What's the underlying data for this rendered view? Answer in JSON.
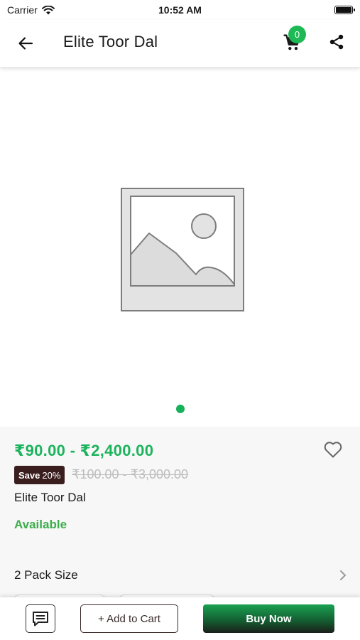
{
  "status_bar": {
    "carrier": "Carrier",
    "time": "10:52 AM"
  },
  "app_bar": {
    "title": "Elite Toor Dal",
    "cart_count": "0"
  },
  "gallery": {
    "slide_count": 1,
    "active_slide": 1
  },
  "product": {
    "price_range": "₹90.00 - ₹2,400.00",
    "save_label": "Save",
    "save_percent": "20%",
    "mrp_range": "₹100.00 - ₹3,000.00",
    "name": "Elite Toor Dal",
    "availability": "Available",
    "pack_size_label": "2 Pack Size"
  },
  "actions": {
    "add_to_cart": "+ Add to Cart",
    "buy_now": "Buy Now"
  },
  "colors": {
    "accent": "#1bb35c",
    "save_badge": "#3a1e1e",
    "available": "#3cae4a"
  }
}
